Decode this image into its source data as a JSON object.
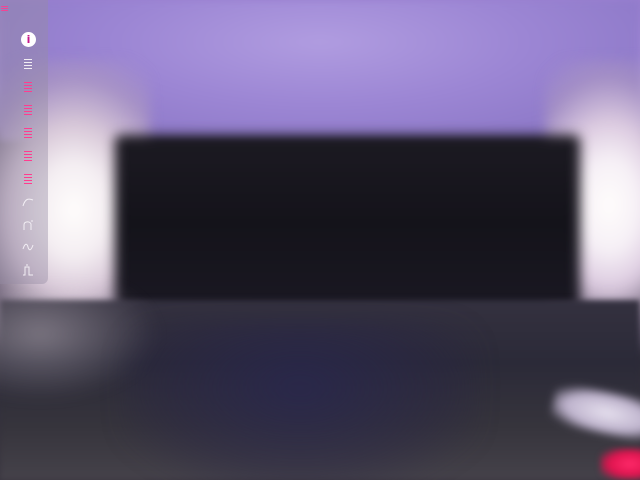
{
  "toolbar": {
    "tools": [
      {
        "name": "info-icon",
        "glyph": "i",
        "color": "#ffffff"
      },
      {
        "name": "menu-lines-white-icon",
        "glyph": "≡",
        "color": "#f2eef4"
      },
      {
        "name": "menu-lines-pink-1-icon",
        "glyph": "≡",
        "color": "#ff3d8f"
      },
      {
        "name": "menu-lines-pink-2-icon",
        "glyph": "≡",
        "color": "#ff3d8f"
      },
      {
        "name": "menu-lines-pink-3-icon",
        "glyph": "≡",
        "color": "#ff3d8f"
      },
      {
        "name": "menu-lines-pink-4-icon",
        "glyph": "≡",
        "color": "#ff3d8f"
      },
      {
        "name": "menu-lines-pink-5-icon",
        "glyph": "≡",
        "color": "#ff3d8f"
      },
      {
        "name": "curve-icon",
        "glyph": "⌒",
        "color": "#f2eef4"
      },
      {
        "name": "curve-alt-icon",
        "glyph": "⟆",
        "color": "#f2eef4"
      },
      {
        "name": "wave-icon",
        "glyph": "∿",
        "color": "#f2eef4"
      },
      {
        "name": "pulse-icon",
        "glyph": "⎍",
        "color": "#f2eef4"
      }
    ],
    "corner_glyph": "≡",
    "accent_color": "#ff3d8f"
  }
}
